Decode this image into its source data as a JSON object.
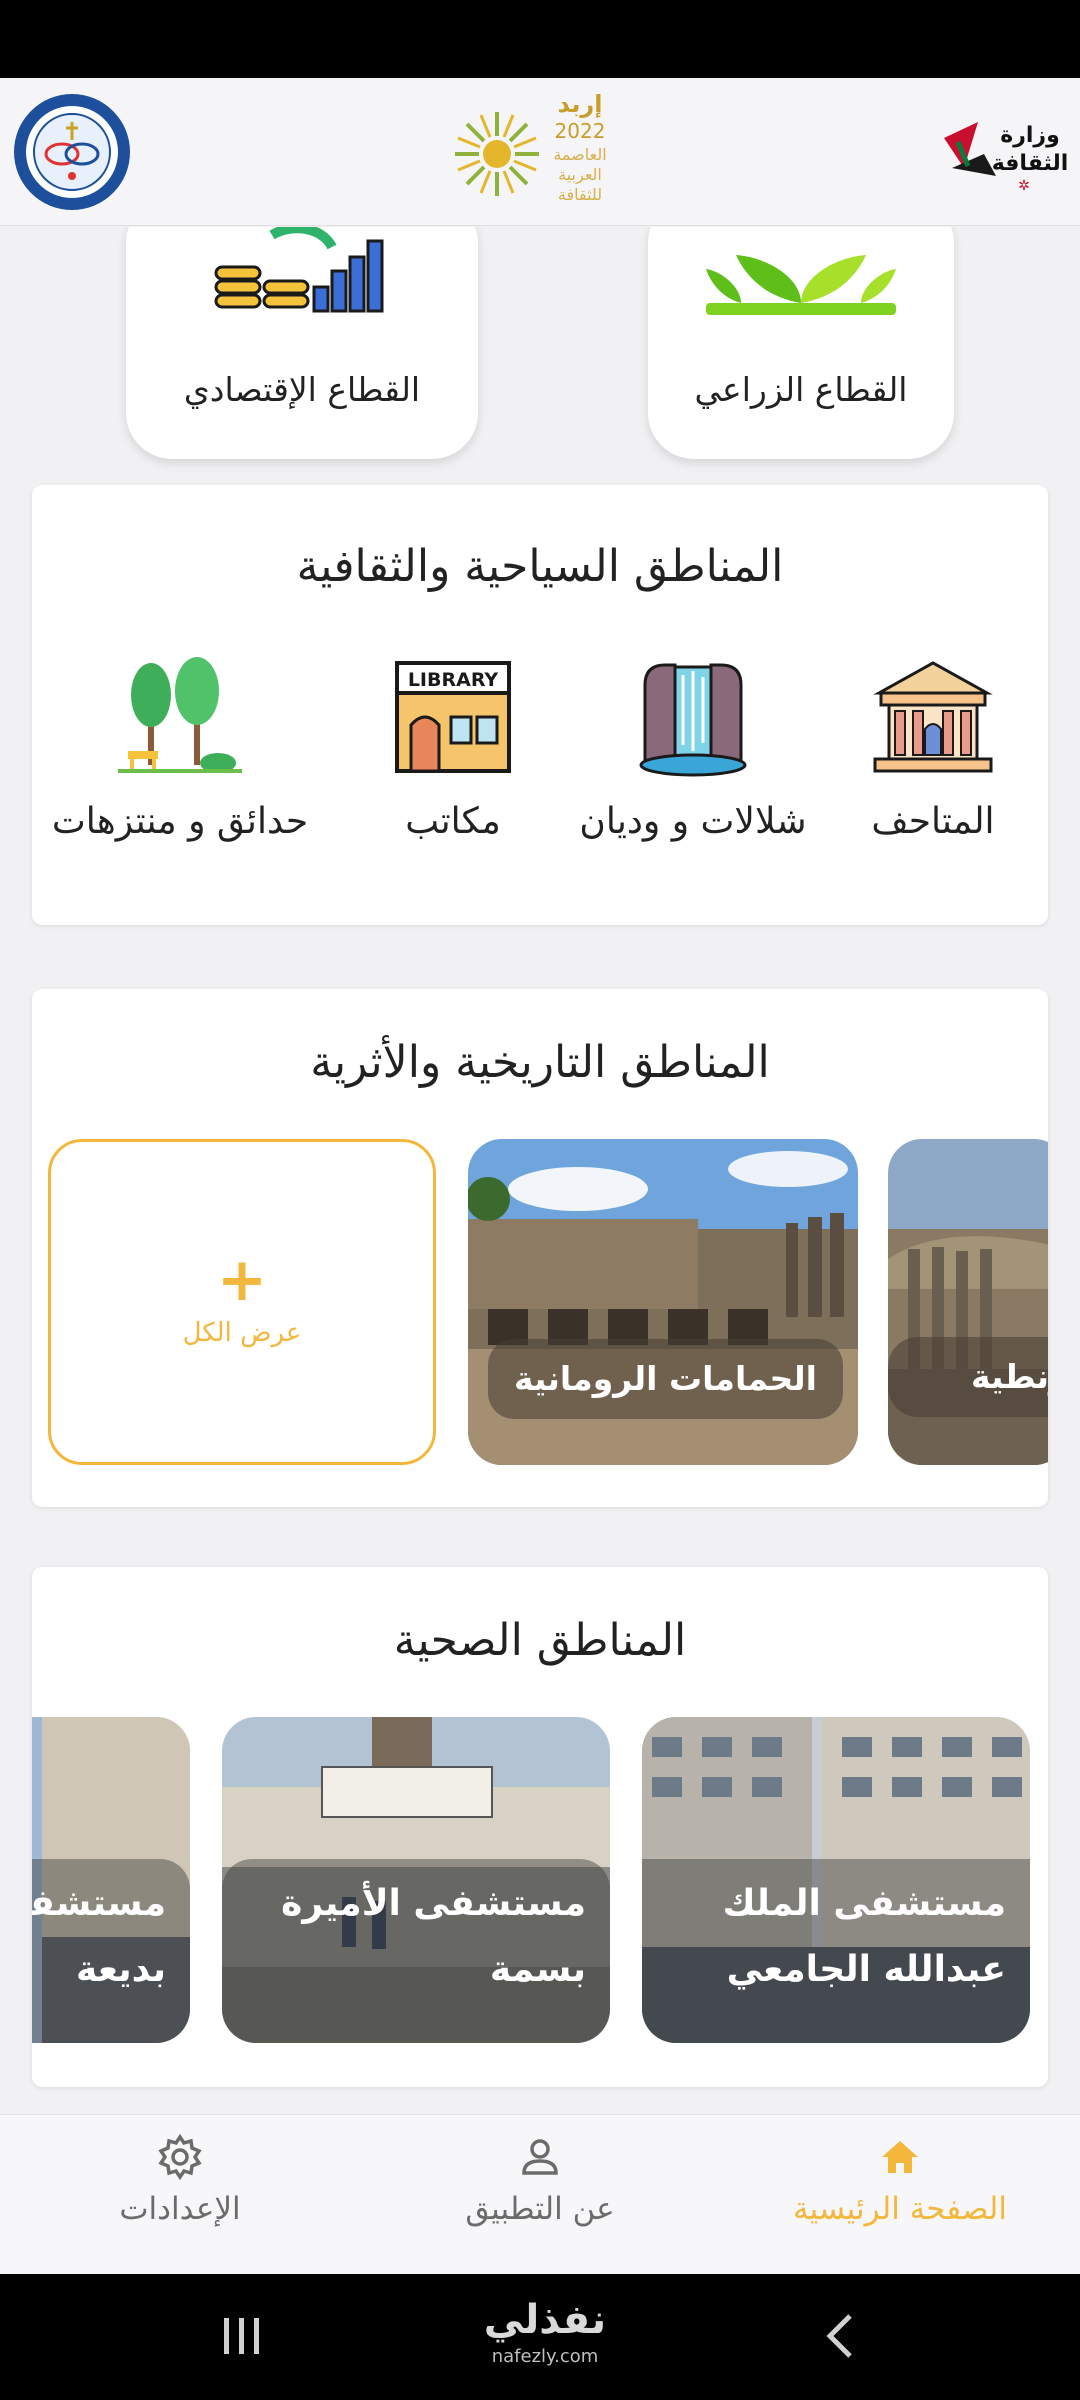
{
  "header": {
    "logo_left": {
      "name": "university-logo"
    },
    "logo_center": {
      "name": "irbid-2022-logo",
      "line1": "إربد",
      "year": "2022",
      "line2": "العاصمة",
      "line3": "العربية",
      "line4": "للثقافة"
    },
    "logo_right": {
      "name": "ministry-of-culture-logo",
      "line1": "وزارة",
      "line2": "الثقافة"
    }
  },
  "sectors": [
    {
      "label": "القطاع الزراعي",
      "icon": "plant-sprout-icon"
    },
    {
      "label": "القطاع الإقتصادي",
      "icon": "coins-chart-icon"
    }
  ],
  "tourism": {
    "title": "المناطق السياحية والثقافية",
    "items": [
      {
        "label": "المتاحف",
        "icon": "museum-icon"
      },
      {
        "label": "شلالات و وديان",
        "icon": "waterfall-icon"
      },
      {
        "label": "مكاتب",
        "icon": "library-icon",
        "sign": "LIBRARY"
      },
      {
        "label": "حدائق و منتزهات",
        "icon": "park-trees-icon"
      }
    ]
  },
  "history": {
    "title": "المناطق التاريخية والأثرية",
    "cards": [
      {
        "label": "زنطية",
        "image": "ruins-photo"
      },
      {
        "label": "الحمامات الرومانية",
        "image": "roman-baths-photo"
      }
    ],
    "view_all": {
      "plus": "+",
      "label": "عرض الكل"
    }
  },
  "health": {
    "title": "المناطق الصحية",
    "cards": [
      {
        "line1": "مستشفى الملك",
        "line2": "عبدالله الجامعي",
        "image": "hospital-building-photo"
      },
      {
        "line1": "مستشفى الأميرة",
        "line2": "بسمة",
        "image": "hospital-entrance-photo"
      },
      {
        "line1": "مستشفى",
        "line2": "بديعة",
        "image": "hospital-street-photo"
      }
    ]
  },
  "bottom_nav": {
    "items": [
      {
        "label": "الصفحة الرئيسية",
        "icon": "home-icon",
        "active": true
      },
      {
        "label": "عن التطبيق",
        "icon": "person-icon",
        "active": false
      },
      {
        "label": "الإعدادات",
        "icon": "gear-icon",
        "active": false
      }
    ]
  },
  "system_nav": {
    "watermark_main": "نفذلي",
    "watermark_sub": "nafezly.com"
  },
  "colors": {
    "accent": "#f3b73b",
    "panel_bg": "#ffffff",
    "page_bg": "#f1f1f3",
    "text_muted": "#6b6b6b"
  }
}
